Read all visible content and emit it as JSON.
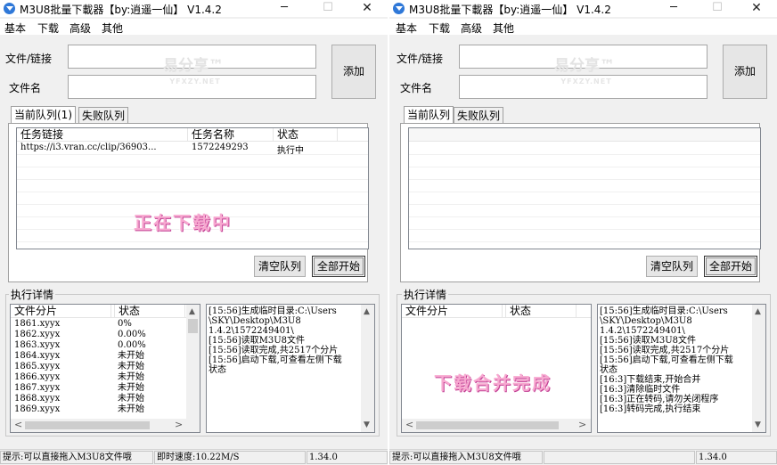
{
  "windows": [
    {
      "title": "M3U8批量下載器【by:逍遥一仙】  V1.4.2",
      "menu": [
        "基本",
        "下载",
        "高级",
        "其他"
      ],
      "file_link_label": "文件/链接",
      "file_name_label": "文件名",
      "watermark": "易分享™",
      "watermark_sub": "YFXZY.NET",
      "add_button": "添加",
      "tabs": [
        "当前队列(1)",
        "失败队列"
      ],
      "queue_columns": [
        "任务链接",
        "任务名称",
        "状态"
      ],
      "queue_rows": [
        {
          "link": "https://i3.vran.cc/clip/36903...",
          "name": "1572249293",
          "status": "执行中"
        }
      ],
      "overlay": "正在下载中",
      "clear_button": "清空队列",
      "start_button": "全部开始",
      "details_title": "执行详情",
      "fragment_columns": [
        "文件分片",
        "状态"
      ],
      "fragments": [
        {
          "name": "1861.xyyx",
          "status": "0%"
        },
        {
          "name": "1862.xyyx",
          "status": "0.00%"
        },
        {
          "name": "1863.xyyx",
          "status": "0.00%"
        },
        {
          "name": "1864.xyyx",
          "status": "未开始"
        },
        {
          "name": "1865.xyyx",
          "status": "未开始"
        },
        {
          "name": "1866.xyyx",
          "status": "未开始"
        },
        {
          "name": "1867.xyyx",
          "status": "未开始"
        },
        {
          "name": "1868.xyyx",
          "status": "未开始"
        },
        {
          "name": "1869.xyyx",
          "status": "未开始"
        }
      ],
      "log_lines": [
        "[15:56]生成临时目录:C:\\Users",
        "\\SKY\\Desktop\\M3U8",
        "1.4.2\\1572249401\\",
        "[15:56]读取M3U8文件",
        "[15:56]读取完成,共2517个分片",
        "[15:56]启动下载,可查看左侧下载",
        "状态"
      ],
      "status_hint": "提示:可以直接拖入M3U8文件哦",
      "status_speed": "即时速度:10.22M/S",
      "status_version": "1.34.0"
    },
    {
      "title": "M3U8批量下載器【by:逍遥一仙】  V1.4.2",
      "menu": [
        "基本",
        "下载",
        "高级",
        "其他"
      ],
      "file_link_label": "文件/链接",
      "file_name_label": "文件名",
      "watermark": "易分享™",
      "watermark_sub": "YFXZY.NET",
      "add_button": "添加",
      "tabs": [
        "当前队列",
        "失败队列"
      ],
      "clear_button": "清空队列",
      "start_button": "全部开始",
      "details_title": "执行详情",
      "fragment_columns": [
        "文件分片",
        "状态"
      ],
      "overlay": "下载合并完成",
      "log_lines": [
        "[15:56]生成临时目录:C:\\Users",
        "\\SKY\\Desktop\\M3U8",
        "1.4.2\\1572249401\\",
        "[15:56]读取M3U8文件",
        "[15:56]读取完成,共2517个分片",
        "[15:56]启动下载,可查看左侧下载",
        "状态",
        "[16:3]下载结束,开始合并",
        "[16:3]清除临时文件",
        "[16:3]正在转码,请勿关闭程序",
        "[16:3]转码完成,执行结束"
      ],
      "status_hint": "提示:可以直接拖入M3U8文件哦",
      "status_speed": "",
      "status_version": "1.34.0"
    }
  ],
  "icons": {
    "minimize": "─",
    "maximize": "☐",
    "close": "✕",
    "scroll_up": "▲",
    "scroll_down": "▼",
    "scroll_left": "<",
    "scroll_right": ">"
  }
}
